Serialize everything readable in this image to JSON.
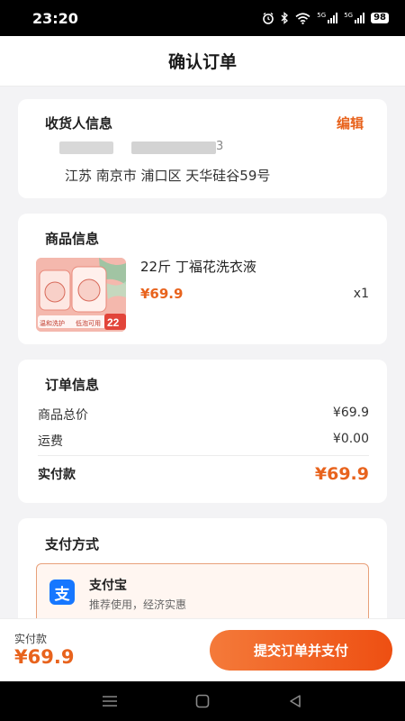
{
  "status_bar": {
    "time": "23:20",
    "net1": "5G",
    "net2": "5G",
    "battery": "98"
  },
  "header": {
    "title": "确认订单"
  },
  "recipient": {
    "section_title": "收货人信息",
    "edit_label": "编辑",
    "masked_tail": "3",
    "address": "江苏 南京市 浦口区 天华硅谷59号"
  },
  "goods": {
    "section_title": "商品信息",
    "name": "22斤 丁福花洗衣液",
    "price": "¥69.9",
    "quantity": "x1",
    "image_texts": {
      "badge": "22",
      "tag_left": "温和洗护",
      "tag_right": "低泡可用"
    }
  },
  "order": {
    "section_title": "订单信息",
    "rows": [
      {
        "label": "商品总价",
        "value": "¥69.9"
      },
      {
        "label": "运费",
        "value": "¥0.00"
      }
    ],
    "total_label": "实付款",
    "total_value": "¥69.9"
  },
  "payment": {
    "section_title": "支付方式",
    "option_icon_glyph": "支",
    "option_name": "支付宝",
    "option_desc": "推荐使用，经济实惠"
  },
  "bottom_bar": {
    "label": "实付款",
    "total": "¥69.9",
    "submit_label": "提交订单并支付"
  },
  "colors": {
    "accent": "#e8631d",
    "alipay_blue": "#1677ff"
  },
  "icons": {
    "status": [
      "alarm-icon",
      "bluetooth-icon",
      "wifi-icon",
      "signal-icon",
      "battery-icon"
    ],
    "nav": [
      "menu-icon",
      "home-icon",
      "back-icon"
    ]
  }
}
